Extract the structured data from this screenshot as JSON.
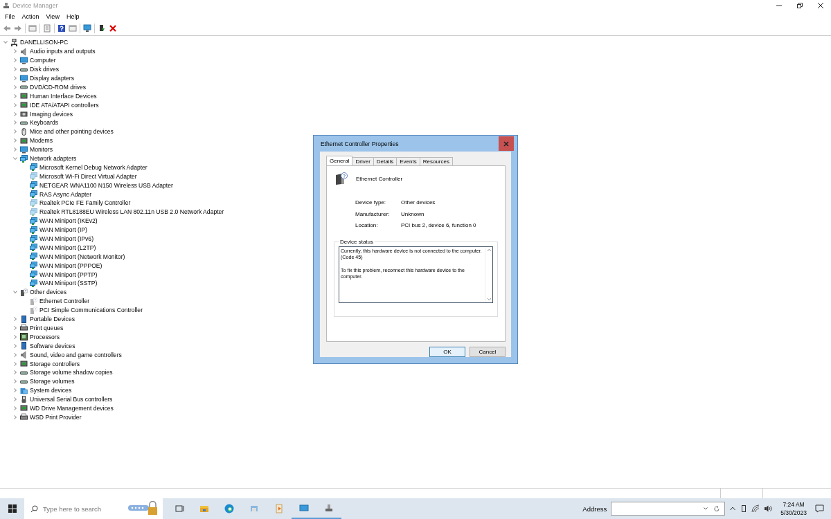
{
  "window": {
    "title": "Device Manager"
  },
  "menu": [
    "File",
    "Action",
    "View",
    "Help"
  ],
  "tree": {
    "label": "DANELLISON-PC",
    "expanded": true,
    "children": [
      {
        "label": "Audio inputs and outputs",
        "kind": "speaker",
        "expanded": false
      },
      {
        "label": "Computer",
        "kind": "monitor",
        "expanded": false
      },
      {
        "label": "Disk drives",
        "kind": "drive",
        "expanded": false
      },
      {
        "label": "Display adapters",
        "kind": "monitor",
        "expanded": false
      },
      {
        "label": "DVD/CD-ROM drives",
        "kind": "drive",
        "expanded": false
      },
      {
        "label": "Human Interface Devices",
        "kind": "chip",
        "expanded": false
      },
      {
        "label": "IDE ATA/ATAPI controllers",
        "kind": "chip",
        "expanded": false
      },
      {
        "label": "Imaging devices",
        "kind": "camera",
        "expanded": false
      },
      {
        "label": "Keyboards",
        "kind": "drive",
        "expanded": false
      },
      {
        "label": "Mice and other pointing devices",
        "kind": "mouse",
        "expanded": false
      },
      {
        "label": "Modems",
        "kind": "chip",
        "expanded": false
      },
      {
        "label": "Monitors",
        "kind": "monitor",
        "expanded": false
      },
      {
        "label": "Network adapters",
        "kind": "network",
        "expanded": true,
        "children": [
          {
            "label": "Microsoft Kernel Debug Network Adapter",
            "kind": "network",
            "hidden": false
          },
          {
            "label": "Microsoft Wi-Fi Direct Virtual Adapter",
            "kind": "network",
            "hidden": true
          },
          {
            "label": "NETGEAR WNA1100 N150 Wireless USB Adapter",
            "kind": "network",
            "hidden": false
          },
          {
            "label": "RAS Async Adapter",
            "kind": "network",
            "hidden": false
          },
          {
            "label": "Realtek PCIe FE Family Controller",
            "kind": "network",
            "hidden": true
          },
          {
            "label": "Realtek RTL8188EU Wireless LAN 802.11n USB 2.0 Network Adapter",
            "kind": "network",
            "hidden": true
          },
          {
            "label": "WAN Miniport (IKEv2)",
            "kind": "network",
            "hidden": false
          },
          {
            "label": "WAN Miniport (IP)",
            "kind": "network",
            "hidden": false
          },
          {
            "label": "WAN Miniport (IPv6)",
            "kind": "network",
            "hidden": false
          },
          {
            "label": "WAN Miniport (L2TP)",
            "kind": "network",
            "hidden": false
          },
          {
            "label": "WAN Miniport (Network Monitor)",
            "kind": "network",
            "hidden": false
          },
          {
            "label": "WAN Miniport (PPPOE)",
            "kind": "network",
            "hidden": false
          },
          {
            "label": "WAN Miniport (PPTP)",
            "kind": "network",
            "hidden": false
          },
          {
            "label": "WAN Miniport (SSTP)",
            "kind": "network",
            "hidden": false
          }
        ]
      },
      {
        "label": "Other devices",
        "kind": "unknown",
        "expanded": true,
        "children": [
          {
            "label": "Ethernet Controller",
            "kind": "unknown",
            "hidden": true
          },
          {
            "label": "PCI Simple Communications Controller",
            "kind": "unknown",
            "hidden": true
          }
        ]
      },
      {
        "label": "Portable Devices",
        "kind": "phone",
        "expanded": false
      },
      {
        "label": "Print queues",
        "kind": "printer",
        "expanded": false
      },
      {
        "label": "Processors",
        "kind": "cpu",
        "expanded": false
      },
      {
        "label": "Software devices",
        "kind": "phone",
        "expanded": false
      },
      {
        "label": "Sound, video and game controllers",
        "kind": "speaker",
        "expanded": false
      },
      {
        "label": "Storage controllers",
        "kind": "chip",
        "expanded": false
      },
      {
        "label": "Storage volume shadow copies",
        "kind": "drive",
        "expanded": false
      },
      {
        "label": "Storage volumes",
        "kind": "drive",
        "expanded": false
      },
      {
        "label": "System devices",
        "kind": "folder",
        "expanded": false
      },
      {
        "label": "Universal Serial Bus controllers",
        "kind": "usb",
        "expanded": false
      },
      {
        "label": "WD Drive Management devices",
        "kind": "chip",
        "expanded": false
      },
      {
        "label": "WSD Print Provider",
        "kind": "printer",
        "expanded": false
      }
    ]
  },
  "dialog": {
    "title": "Ethernet Controller Properties",
    "tabs": [
      {
        "label": "General",
        "selected": true
      },
      {
        "label": "Driver",
        "selected": false
      },
      {
        "label": "Details",
        "selected": false
      },
      {
        "label": "Events",
        "selected": false
      },
      {
        "label": "Resources",
        "selected": false
      }
    ],
    "device_name": "Ethernet Controller",
    "properties": [
      {
        "label": "Device type:",
        "value": "Other devices"
      },
      {
        "label": "Manufacturer:",
        "value": "Unknown"
      },
      {
        "label": "Location:",
        "value": "PCI bus 2, device 6, function 0"
      }
    ],
    "status_label": "Device status",
    "status_text": "Currently, this hardware device is not connected to the computer. (Code 45)\n\nTo fix this problem, reconnect this hardware device to the computer.",
    "buttons": [
      "OK",
      "Cancel"
    ]
  },
  "taskbar": {
    "search_placeholder": "Type here to search",
    "address_label": "Address",
    "time": "7:24 AM",
    "date": "5/30/2023"
  }
}
